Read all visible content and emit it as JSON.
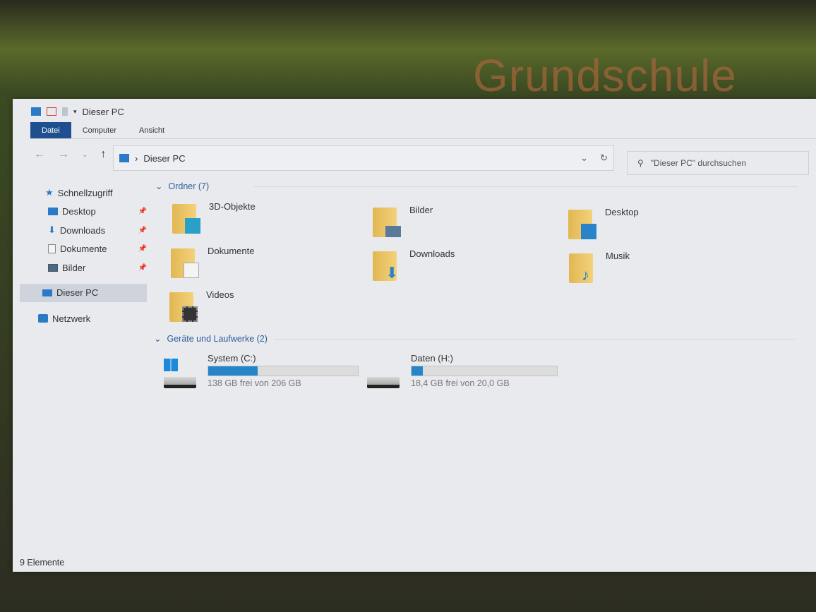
{
  "background": {
    "wallpaper_text": "Grundschule"
  },
  "window": {
    "title": "Dieser PC"
  },
  "ribbon": {
    "tabs": [
      "Datei",
      "Computer",
      "Ansicht"
    ]
  },
  "address": {
    "path": "Dieser PC",
    "search_placeholder": "\"Dieser PC\" durchsuchen"
  },
  "sidebar": {
    "quick_access": "Schnellzugriff",
    "items": [
      {
        "label": "Desktop",
        "pinned": true
      },
      {
        "label": "Downloads",
        "pinned": true
      },
      {
        "label": "Dokumente",
        "pinned": true
      },
      {
        "label": "Bilder",
        "pinned": true
      }
    ],
    "this_pc": "Dieser PC",
    "network": "Netzwerk"
  },
  "folders": {
    "header": "Ordner (7)",
    "items": [
      "3D-Objekte",
      "Bilder",
      "Desktop",
      "Dokumente",
      "Downloads",
      "Musik",
      "Videos"
    ]
  },
  "drives": {
    "header": "Geräte und Laufwerke (2)",
    "items": [
      {
        "name": "System (C:)",
        "free": "138 GB frei von 206 GB",
        "used_percent": 33,
        "icon": "windows-drive-icon"
      },
      {
        "name": "Daten (H:)",
        "free": "18,4 GB frei von 20,0 GB",
        "used_percent": 8,
        "icon": "drive-icon"
      }
    ]
  },
  "status": {
    "count": "9 Elemente"
  },
  "colors": {
    "accent": "#1f4f8f",
    "bar": "#2585c8"
  }
}
